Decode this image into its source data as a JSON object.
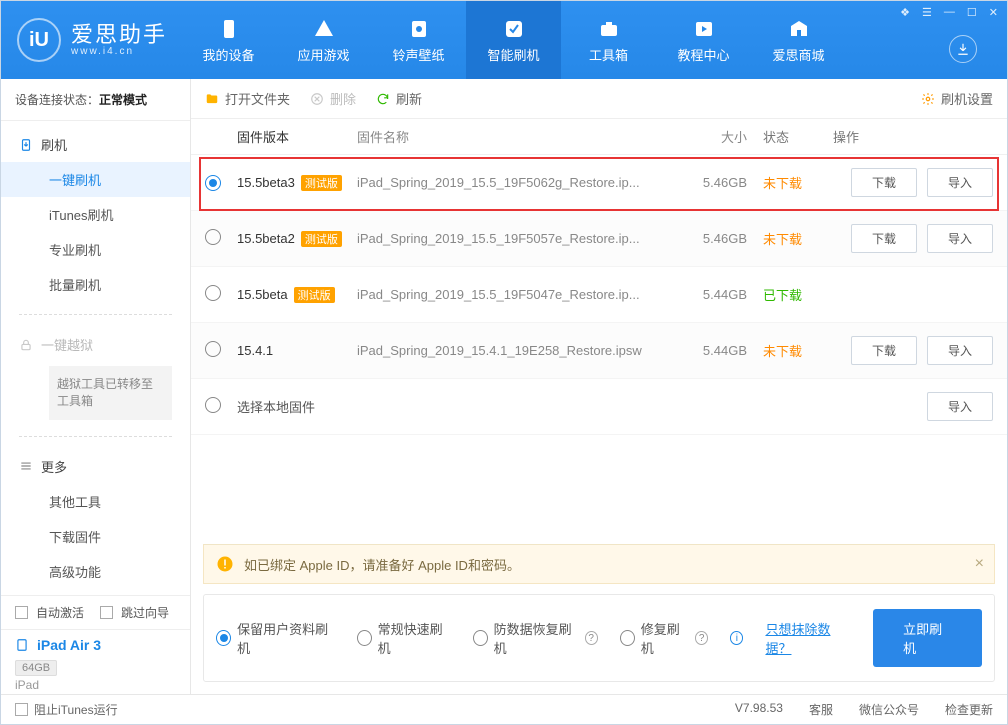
{
  "branding": {
    "name": "爱思助手",
    "domain": "www.i4.cn",
    "logo_letters": "iU"
  },
  "top_nav": [
    {
      "label": "我的设备"
    },
    {
      "label": "应用游戏"
    },
    {
      "label": "铃声壁纸"
    },
    {
      "label": "智能刷机",
      "active": true
    },
    {
      "label": "工具箱"
    },
    {
      "label": "教程中心"
    },
    {
      "label": "爱思商城"
    }
  ],
  "connection": {
    "prefix": "设备连接状态：",
    "value": "正常模式"
  },
  "sidebar": {
    "flash": {
      "heading": "刷机",
      "items": [
        "一键刷机",
        "iTunes刷机",
        "专业刷机",
        "批量刷机"
      ]
    },
    "jailbreak": {
      "heading": "一键越狱",
      "note": "越狱工具已转移至工具箱"
    },
    "more": {
      "heading": "更多",
      "items": [
        "其他工具",
        "下载固件",
        "高级功能"
      ]
    },
    "auto_activate": "自动激活",
    "skip_guide": "跳过向导"
  },
  "device": {
    "name": "iPad Air 3",
    "capacity": "64GB",
    "type": "iPad"
  },
  "toolbar": {
    "open_folder": "打开文件夹",
    "delete": "删除",
    "refresh": "刷新",
    "settings": "刷机设置"
  },
  "headers": {
    "version": "固件版本",
    "filename": "固件名称",
    "size": "大小",
    "status": "状态",
    "action": "操作"
  },
  "buttons": {
    "download": "下载",
    "import": "导入"
  },
  "beta_tag": "测试版",
  "rows": [
    {
      "version": "15.5beta3",
      "beta": true,
      "filename": "iPad_Spring_2019_15.5_19F5062g_Restore.ip...",
      "size": "5.46GB",
      "status": "未下载",
      "status_class": "st-nodl",
      "selected": true
    },
    {
      "version": "15.5beta2",
      "beta": true,
      "filename": "iPad_Spring_2019_15.5_19F5057e_Restore.ip...",
      "size": "5.46GB",
      "status": "未下载",
      "status_class": "st-nodl",
      "selected": false
    },
    {
      "version": "15.5beta",
      "beta": true,
      "filename": "iPad_Spring_2019_15.5_19F5047e_Restore.ip...",
      "size": "5.44GB",
      "status": "已下载",
      "status_class": "st-dled",
      "selected": false,
      "no_buttons": true
    },
    {
      "version": "15.4.1",
      "beta": false,
      "filename": "iPad_Spring_2019_15.4.1_19E258_Restore.ipsw",
      "size": "5.44GB",
      "status": "未下载",
      "status_class": "st-nodl",
      "selected": false
    },
    {
      "version": "选择本地固件",
      "local": true
    }
  ],
  "alert": "如已绑定 Apple ID，请准备好 Apple ID和密码。",
  "options": {
    "opt1": "保留用户资料刷机",
    "opt2": "常规快速刷机",
    "opt3": "防数据恢复刷机",
    "opt4": "修复刷机",
    "erase_link": "只想抹除数据？",
    "go": "立即刷机"
  },
  "statusbar": {
    "block_itunes": "阻止iTunes运行",
    "version": "V7.98.53",
    "service": "客服",
    "wechat": "微信公众号",
    "check_update": "检查更新"
  }
}
